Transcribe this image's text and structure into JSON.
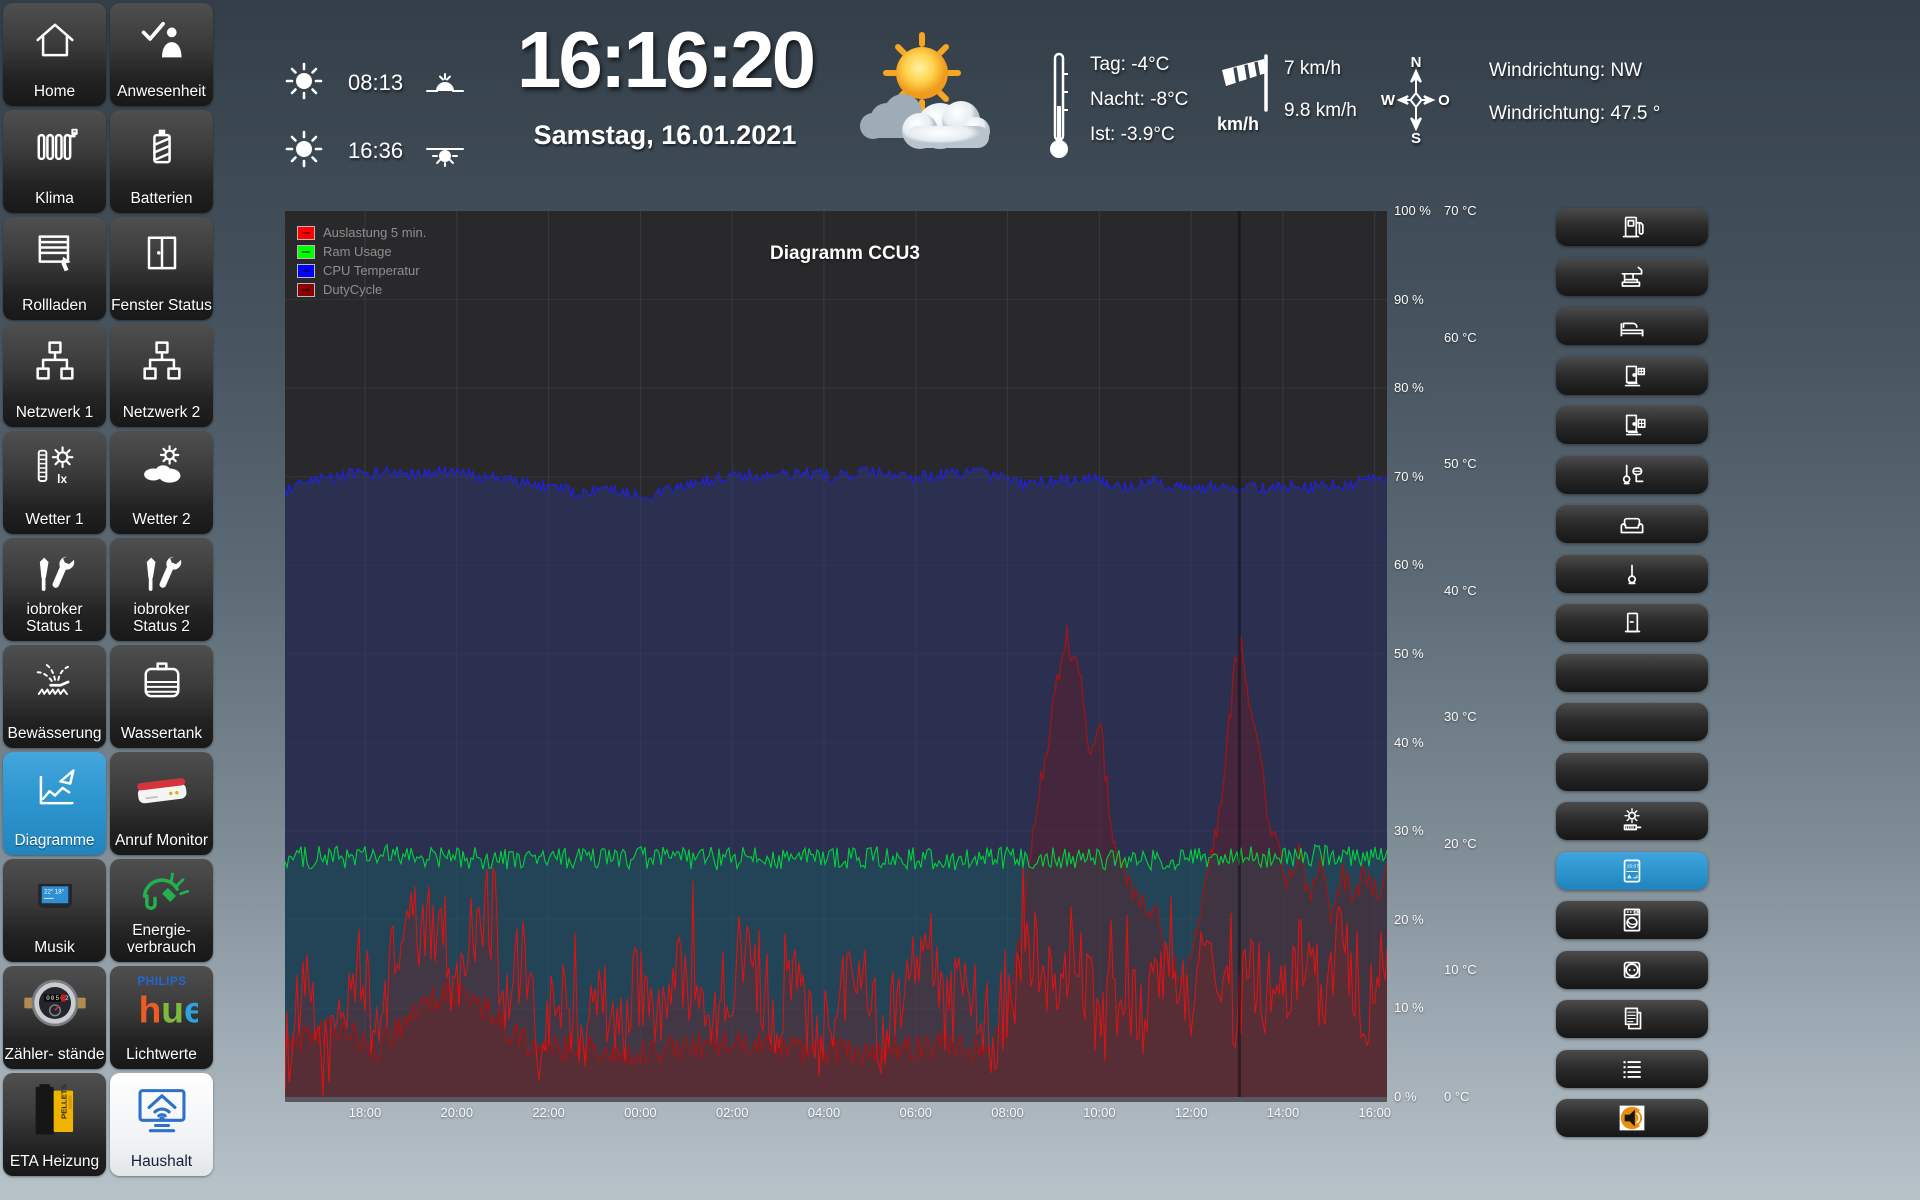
{
  "header": {
    "sunrise_time": "08:13",
    "sunset_time": "16:36",
    "clock": "16:16:20",
    "date": "Samstag, 16.01.2021",
    "temp_day": "Tag: -4°C",
    "temp_night": "Nacht: -8°C",
    "temp_current": "Ist: -3.9°C",
    "wind_unit": "km/h",
    "wind_speed_1": "7 km/h",
    "wind_speed_2": "9.8 km/h",
    "compass": {
      "north": "N",
      "west": "W",
      "east": "O",
      "south": "S"
    },
    "wind_direction_text": "Windrichtung: NW",
    "wind_direction_deg": "Windrichtung: 47.5 °"
  },
  "sidebar": {
    "tiles": [
      {
        "label": "Home",
        "icon": "home"
      },
      {
        "label": "Anwesenheit",
        "icon": "presence"
      },
      {
        "label": "Klima",
        "icon": "radiator"
      },
      {
        "label": "Batterien",
        "icon": "battery"
      },
      {
        "label": "Rollladen",
        "icon": "shutter"
      },
      {
        "label": "Fenster Status",
        "icon": "window"
      },
      {
        "label": "Netzwerk 1",
        "icon": "network"
      },
      {
        "label": "Netzwerk 2",
        "icon": "network"
      },
      {
        "label": "Wetter 1",
        "icon": "weather-lux"
      },
      {
        "label": "Wetter 2",
        "icon": "weather-clouds"
      },
      {
        "label": "iobroker Status 1",
        "icon": "tools"
      },
      {
        "label": "iobroker Status 2",
        "icon": "tools"
      },
      {
        "label": "Bewässerung",
        "icon": "irrigation"
      },
      {
        "label": "Wassertank",
        "icon": "watertank"
      },
      {
        "label": "Diagramme",
        "icon": "charts",
        "active": true
      },
      {
        "label": "Anruf Monitor",
        "icon": "fritzbox"
      },
      {
        "label": "Musik",
        "icon": "echo-show"
      },
      {
        "label": "Energie-verbrauch",
        "icon": "energy"
      },
      {
        "label": "Zähler- stände",
        "icon": "watermeter"
      },
      {
        "label": "Lichtwerte",
        "icon": "philips-hue"
      },
      {
        "label": "ETA Heizung",
        "icon": "pellet-boiler"
      },
      {
        "label": "Haushalt",
        "icon": "household",
        "light": true
      }
    ]
  },
  "right_panel": {
    "buttons": [
      {
        "icon": "fuel-pump"
      },
      {
        "icon": "living-room"
      },
      {
        "icon": "bed"
      },
      {
        "icon": "entrance-door"
      },
      {
        "icon": "entrance-door-2"
      },
      {
        "icon": "bathroom"
      },
      {
        "icon": "sofa"
      },
      {
        "icon": "wc-brush"
      },
      {
        "icon": "door"
      },
      {
        "icon": "none"
      },
      {
        "icon": "none"
      },
      {
        "icon": "none"
      },
      {
        "icon": "brightness"
      },
      {
        "icon": "display-panel",
        "active": true
      },
      {
        "icon": "washing-machine"
      },
      {
        "icon": "power-socket"
      },
      {
        "icon": "documents"
      },
      {
        "icon": "list"
      },
      {
        "icon": "speaker"
      }
    ]
  },
  "chart_data": {
    "type": "line",
    "title": "Diagramm CCU3",
    "x_ticks": [
      "18:00",
      "20:00",
      "22:00",
      "00:00",
      "02:00",
      "04:00",
      "06:00",
      "08:00",
      "10:00",
      "12:00",
      "14:00",
      "16:00"
    ],
    "left_axis": {
      "unit": "%",
      "min": 0,
      "max": 100,
      "ticks": [
        "100 %",
        "90 %",
        "80 %",
        "70 %",
        "60 %",
        "50 %",
        "40 %",
        "30 %",
        "20 %",
        "10 %",
        "0 %"
      ]
    },
    "right_axis": {
      "unit": "°C",
      "min": 0,
      "max": 70,
      "ticks": [
        "70 °C",
        "60 °C",
        "50 °C",
        "40 °C",
        "30 °C",
        "20 °C",
        "10 °C",
        "0 °C"
      ]
    },
    "legend": [
      {
        "label": "Auslastung 5 min.",
        "color": "#ff0000"
      },
      {
        "label": "Ram Usage",
        "color": "#00ff00"
      },
      {
        "label": "CPU Temperatur",
        "color": "#0000ff"
      },
      {
        "label": "DutyCycle",
        "color": "#8b0000"
      }
    ],
    "cursor_x_frac": 0.866,
    "series": [
      {
        "name": "Auslastung 5 min.",
        "axis": "left",
        "unit": "%",
        "color": "#d81414",
        "fill": "rgba(160,25,25,0.26)",
        "jitter": 5,
        "spike_prob": 0.05,
        "spike_amp": 9,
        "points": [
          [
            0,
            5
          ],
          [
            0.02,
            12
          ],
          [
            0.035,
            4
          ],
          [
            0.05,
            9
          ],
          [
            0.07,
            16
          ],
          [
            0.08,
            6
          ],
          [
            0.095,
            14
          ],
          [
            0.11,
            20
          ],
          [
            0.125,
            18
          ],
          [
            0.14,
            21
          ],
          [
            0.155,
            12
          ],
          [
            0.17,
            19
          ],
          [
            0.185,
            22
          ],
          [
            0.2,
            10
          ],
          [
            0.215,
            16
          ],
          [
            0.23,
            5
          ],
          [
            0.25,
            12
          ],
          [
            0.27,
            7
          ],
          [
            0.285,
            14
          ],
          [
            0.3,
            6
          ],
          [
            0.32,
            13
          ],
          [
            0.34,
            8
          ],
          [
            0.36,
            15
          ],
          [
            0.38,
            7
          ],
          [
            0.4,
            12
          ],
          [
            0.42,
            18
          ],
          [
            0.44,
            8
          ],
          [
            0.46,
            14
          ],
          [
            0.48,
            6
          ],
          [
            0.5,
            11
          ],
          [
            0.52,
            16
          ],
          [
            0.54,
            7
          ],
          [
            0.56,
            13
          ],
          [
            0.58,
            19
          ],
          [
            0.6,
            9
          ],
          [
            0.62,
            15
          ],
          [
            0.64,
            7
          ],
          [
            0.66,
            12
          ],
          [
            0.68,
            18
          ],
          [
            0.7,
            10
          ],
          [
            0.72,
            16
          ],
          [
            0.74,
            8
          ],
          [
            0.76,
            13
          ],
          [
            0.78,
            9
          ],
          [
            0.8,
            15
          ],
          [
            0.82,
            11
          ],
          [
            0.84,
            17
          ],
          [
            0.86,
            9
          ],
          [
            0.88,
            14
          ],
          [
            0.9,
            10
          ],
          [
            0.92,
            16
          ],
          [
            0.94,
            12
          ],
          [
            0.96,
            18
          ],
          [
            0.98,
            10
          ],
          [
            1,
            14
          ]
        ]
      },
      {
        "name": "Ram Usage",
        "axis": "left",
        "unit": "%",
        "color": "#00d23c",
        "fill": "rgba(0,150,110,0.20)",
        "jitter": 1.3,
        "points": [
          [
            0,
            27
          ],
          [
            0.1,
            27.2
          ],
          [
            0.2,
            26.8
          ],
          [
            0.3,
            27
          ],
          [
            0.4,
            26.9
          ],
          [
            0.5,
            27.1
          ],
          [
            0.6,
            26.8
          ],
          [
            0.7,
            27
          ],
          [
            0.8,
            26.7
          ],
          [
            0.9,
            27.1
          ],
          [
            1,
            27.3
          ]
        ]
      },
      {
        "name": "CPU Temperatur",
        "axis": "right",
        "unit": "°C",
        "color": "#1f1fe8",
        "fill": "rgba(48,54,112,0.55)",
        "jitter": 0.5,
        "points": [
          [
            0,
            47.9
          ],
          [
            0.03,
            48.7
          ],
          [
            0.06,
            49.2
          ],
          [
            0.09,
            49.4
          ],
          [
            0.12,
            49.1
          ],
          [
            0.15,
            49.4
          ],
          [
            0.18,
            49.0
          ],
          [
            0.21,
            48.7
          ],
          [
            0.24,
            48.2
          ],
          [
            0.27,
            47.7
          ],
          [
            0.3,
            48.0
          ],
          [
            0.33,
            47.5
          ],
          [
            0.35,
            47.9
          ],
          [
            0.38,
            48.7
          ],
          [
            0.41,
            49.1
          ],
          [
            0.44,
            49.0
          ],
          [
            0.47,
            49.3
          ],
          [
            0.5,
            49.0
          ],
          [
            0.53,
            49.4
          ],
          [
            0.56,
            48.9
          ],
          [
            0.59,
            49.1
          ],
          [
            0.62,
            49.4
          ],
          [
            0.65,
            49.0
          ],
          [
            0.67,
            48.4
          ],
          [
            0.7,
            48.7
          ],
          [
            0.73,
            48.9
          ],
          [
            0.76,
            48.2
          ],
          [
            0.79,
            48.6
          ],
          [
            0.82,
            48.0
          ],
          [
            0.85,
            48.4
          ],
          [
            0.88,
            48.1
          ],
          [
            0.91,
            48.3
          ],
          [
            0.94,
            48.2
          ],
          [
            0.97,
            48.5
          ],
          [
            1,
            48.9
          ]
        ]
      },
      {
        "name": "DutyCycle",
        "axis": "left",
        "unit": "%",
        "color": "#9c1616",
        "fill": "rgba(130,20,20,0.30)",
        "jitter": 1.6,
        "points": [
          [
            0,
            6
          ],
          [
            0.05,
            8
          ],
          [
            0.08,
            5
          ],
          [
            0.12,
            10
          ],
          [
            0.15,
            12
          ],
          [
            0.18,
            10
          ],
          [
            0.22,
            6
          ],
          [
            0.3,
            5
          ],
          [
            0.4,
            6
          ],
          [
            0.5,
            5
          ],
          [
            0.6,
            6
          ],
          [
            0.63,
            5
          ],
          [
            0.655,
            8
          ],
          [
            0.67,
            20
          ],
          [
            0.685,
            35
          ],
          [
            0.7,
            46
          ],
          [
            0.71,
            52
          ],
          [
            0.72,
            48
          ],
          [
            0.73,
            40
          ],
          [
            0.74,
            42
          ],
          [
            0.75,
            30
          ],
          [
            0.77,
            22
          ],
          [
            0.79,
            21
          ],
          [
            0.8,
            15
          ],
          [
            0.815,
            14
          ],
          [
            0.83,
            20
          ],
          [
            0.845,
            30
          ],
          [
            0.855,
            40
          ],
          [
            0.862,
            48
          ],
          [
            0.868,
            52
          ],
          [
            0.875,
            45
          ],
          [
            0.885,
            38
          ],
          [
            0.895,
            30
          ],
          [
            0.91,
            24
          ],
          [
            0.92,
            28
          ],
          [
            0.93,
            22
          ],
          [
            0.94,
            26
          ],
          [
            0.95,
            20
          ],
          [
            0.96,
            25
          ],
          [
            0.97,
            22
          ],
          [
            0.98,
            26
          ],
          [
            0.99,
            23
          ],
          [
            1,
            25
          ]
        ]
      }
    ]
  }
}
